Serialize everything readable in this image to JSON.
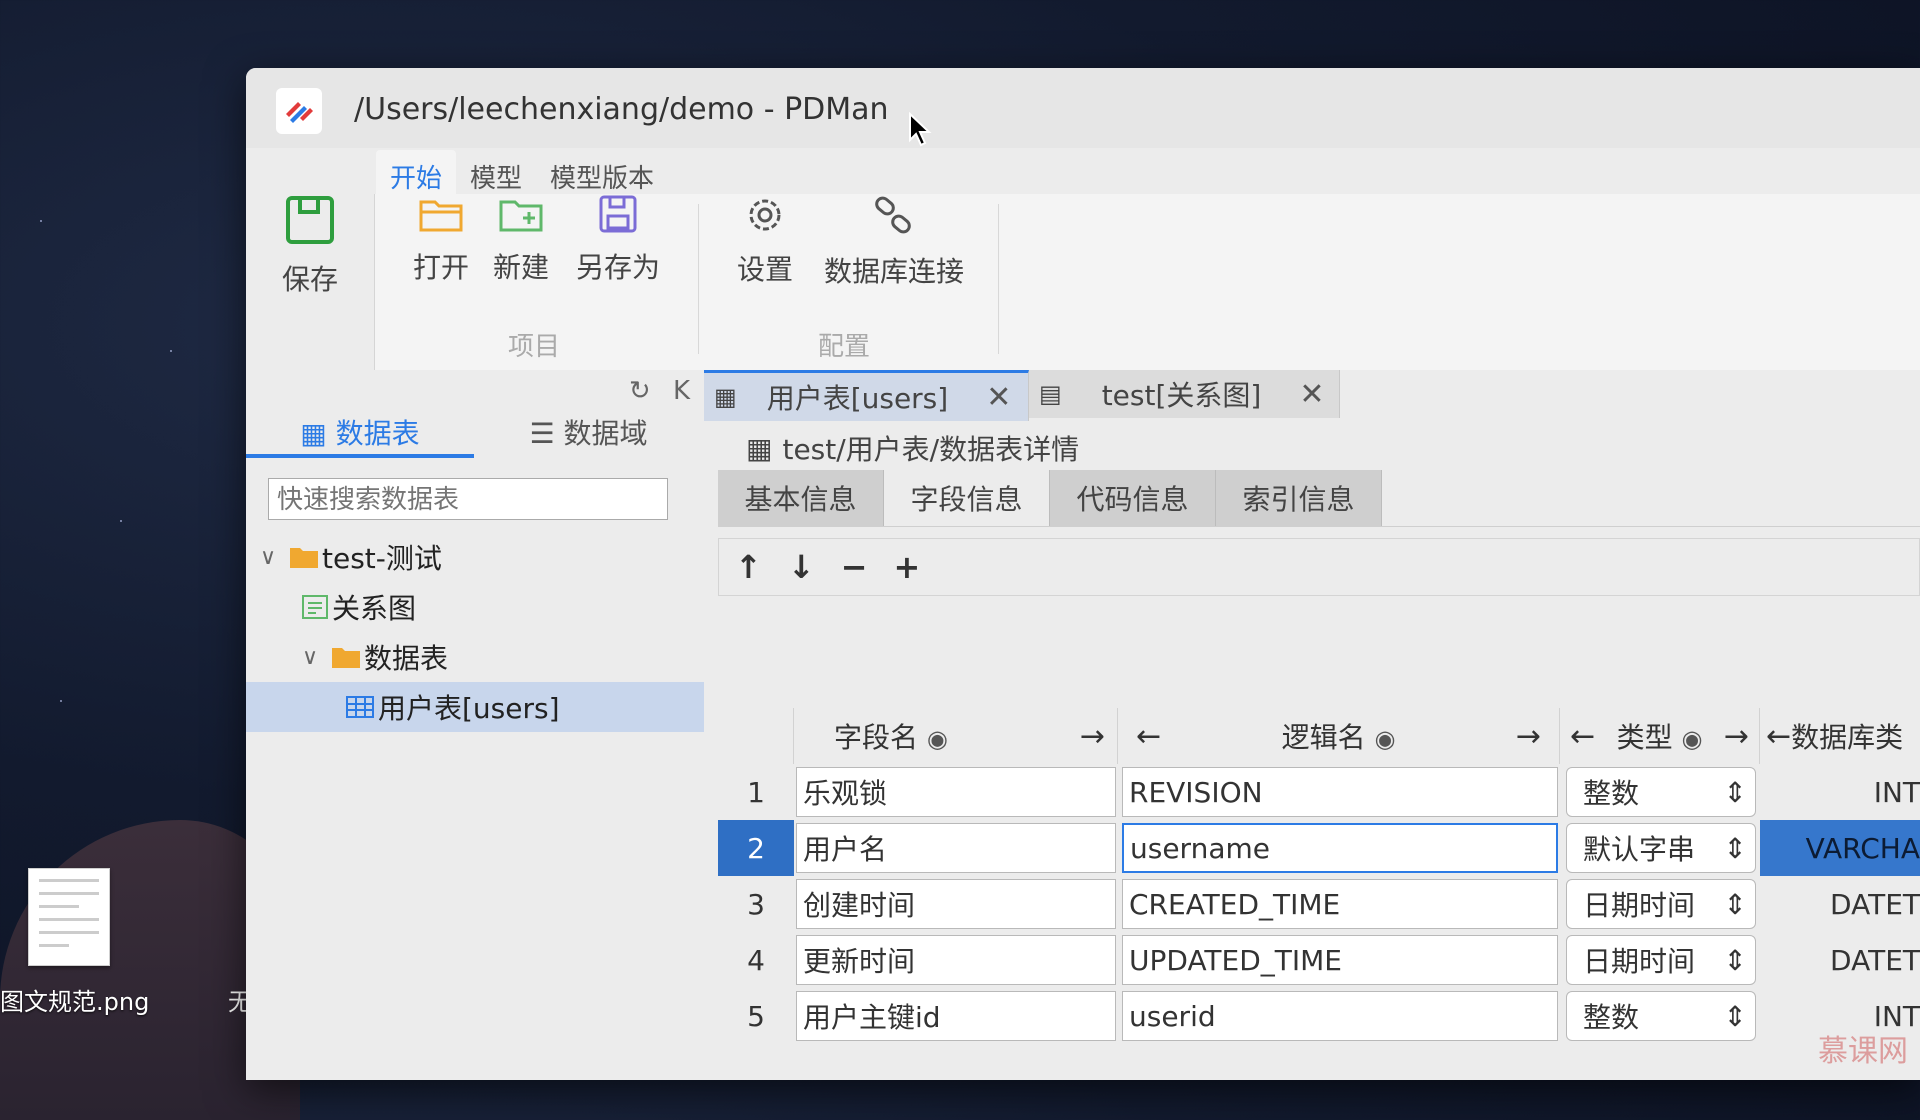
{
  "window": {
    "title": "/Users/leechenxiang/demo - PDMan"
  },
  "ribbon": {
    "tabs": [
      "开始",
      "模型",
      "模型版本"
    ],
    "save_label": "保存",
    "project": {
      "open_label": "打开",
      "new_label": "新建",
      "save_as_label": "另存为",
      "group_label": "项目"
    },
    "config": {
      "settings_label": "设置",
      "db_connect_label": "数据库连接",
      "group_label": "配置"
    }
  },
  "left_panel": {
    "tabs": [
      "数据表",
      "数据域"
    ],
    "search_placeholder": "快速搜索数据表",
    "tree": {
      "module": "test-测试",
      "diagram": "关系图",
      "folder": "数据表",
      "table": "用户表[users]"
    }
  },
  "doc_tabs": [
    {
      "label": "用户表[users]",
      "active": true
    },
    {
      "label": "test[关系图]",
      "active": false
    }
  ],
  "breadcrumb": "test/用户表/数据表详情",
  "sub_tabs": [
    "基本信息",
    "字段信息",
    "代码信息",
    "索引信息"
  ],
  "toolbar": {
    "up": "↑",
    "down": "↓",
    "remove": "−",
    "add": "+"
  },
  "grid": {
    "headers": {
      "field_name": "字段名",
      "logic_name": "逻辑名",
      "type": "类型",
      "db_type": "数据库类"
    },
    "rows": [
      {
        "no": "1",
        "name": "乐观锁",
        "logic": "REVISION",
        "type": "整数",
        "db": "INT"
      },
      {
        "no": "2",
        "name": "用户名",
        "logic": "username",
        "type": "默认字串",
        "db": "VARCHA"
      },
      {
        "no": "3",
        "name": "创建时间",
        "logic": "CREATED_TIME",
        "type": "日期时间",
        "db": "DATET"
      },
      {
        "no": "4",
        "name": "更新时间",
        "logic": "UPDATED_TIME",
        "type": "日期时间",
        "db": "DATET"
      },
      {
        "no": "5",
        "name": "用户主键id",
        "logic": "userid",
        "type": "整数",
        "db": "INT"
      }
    ]
  },
  "desktop": {
    "file_name": "图文规范.png",
    "file_name2": "无"
  },
  "watermark": "慕课网",
  "colors": {
    "accent": "#2c7be5",
    "selected_row": "#2f6fc4"
  }
}
